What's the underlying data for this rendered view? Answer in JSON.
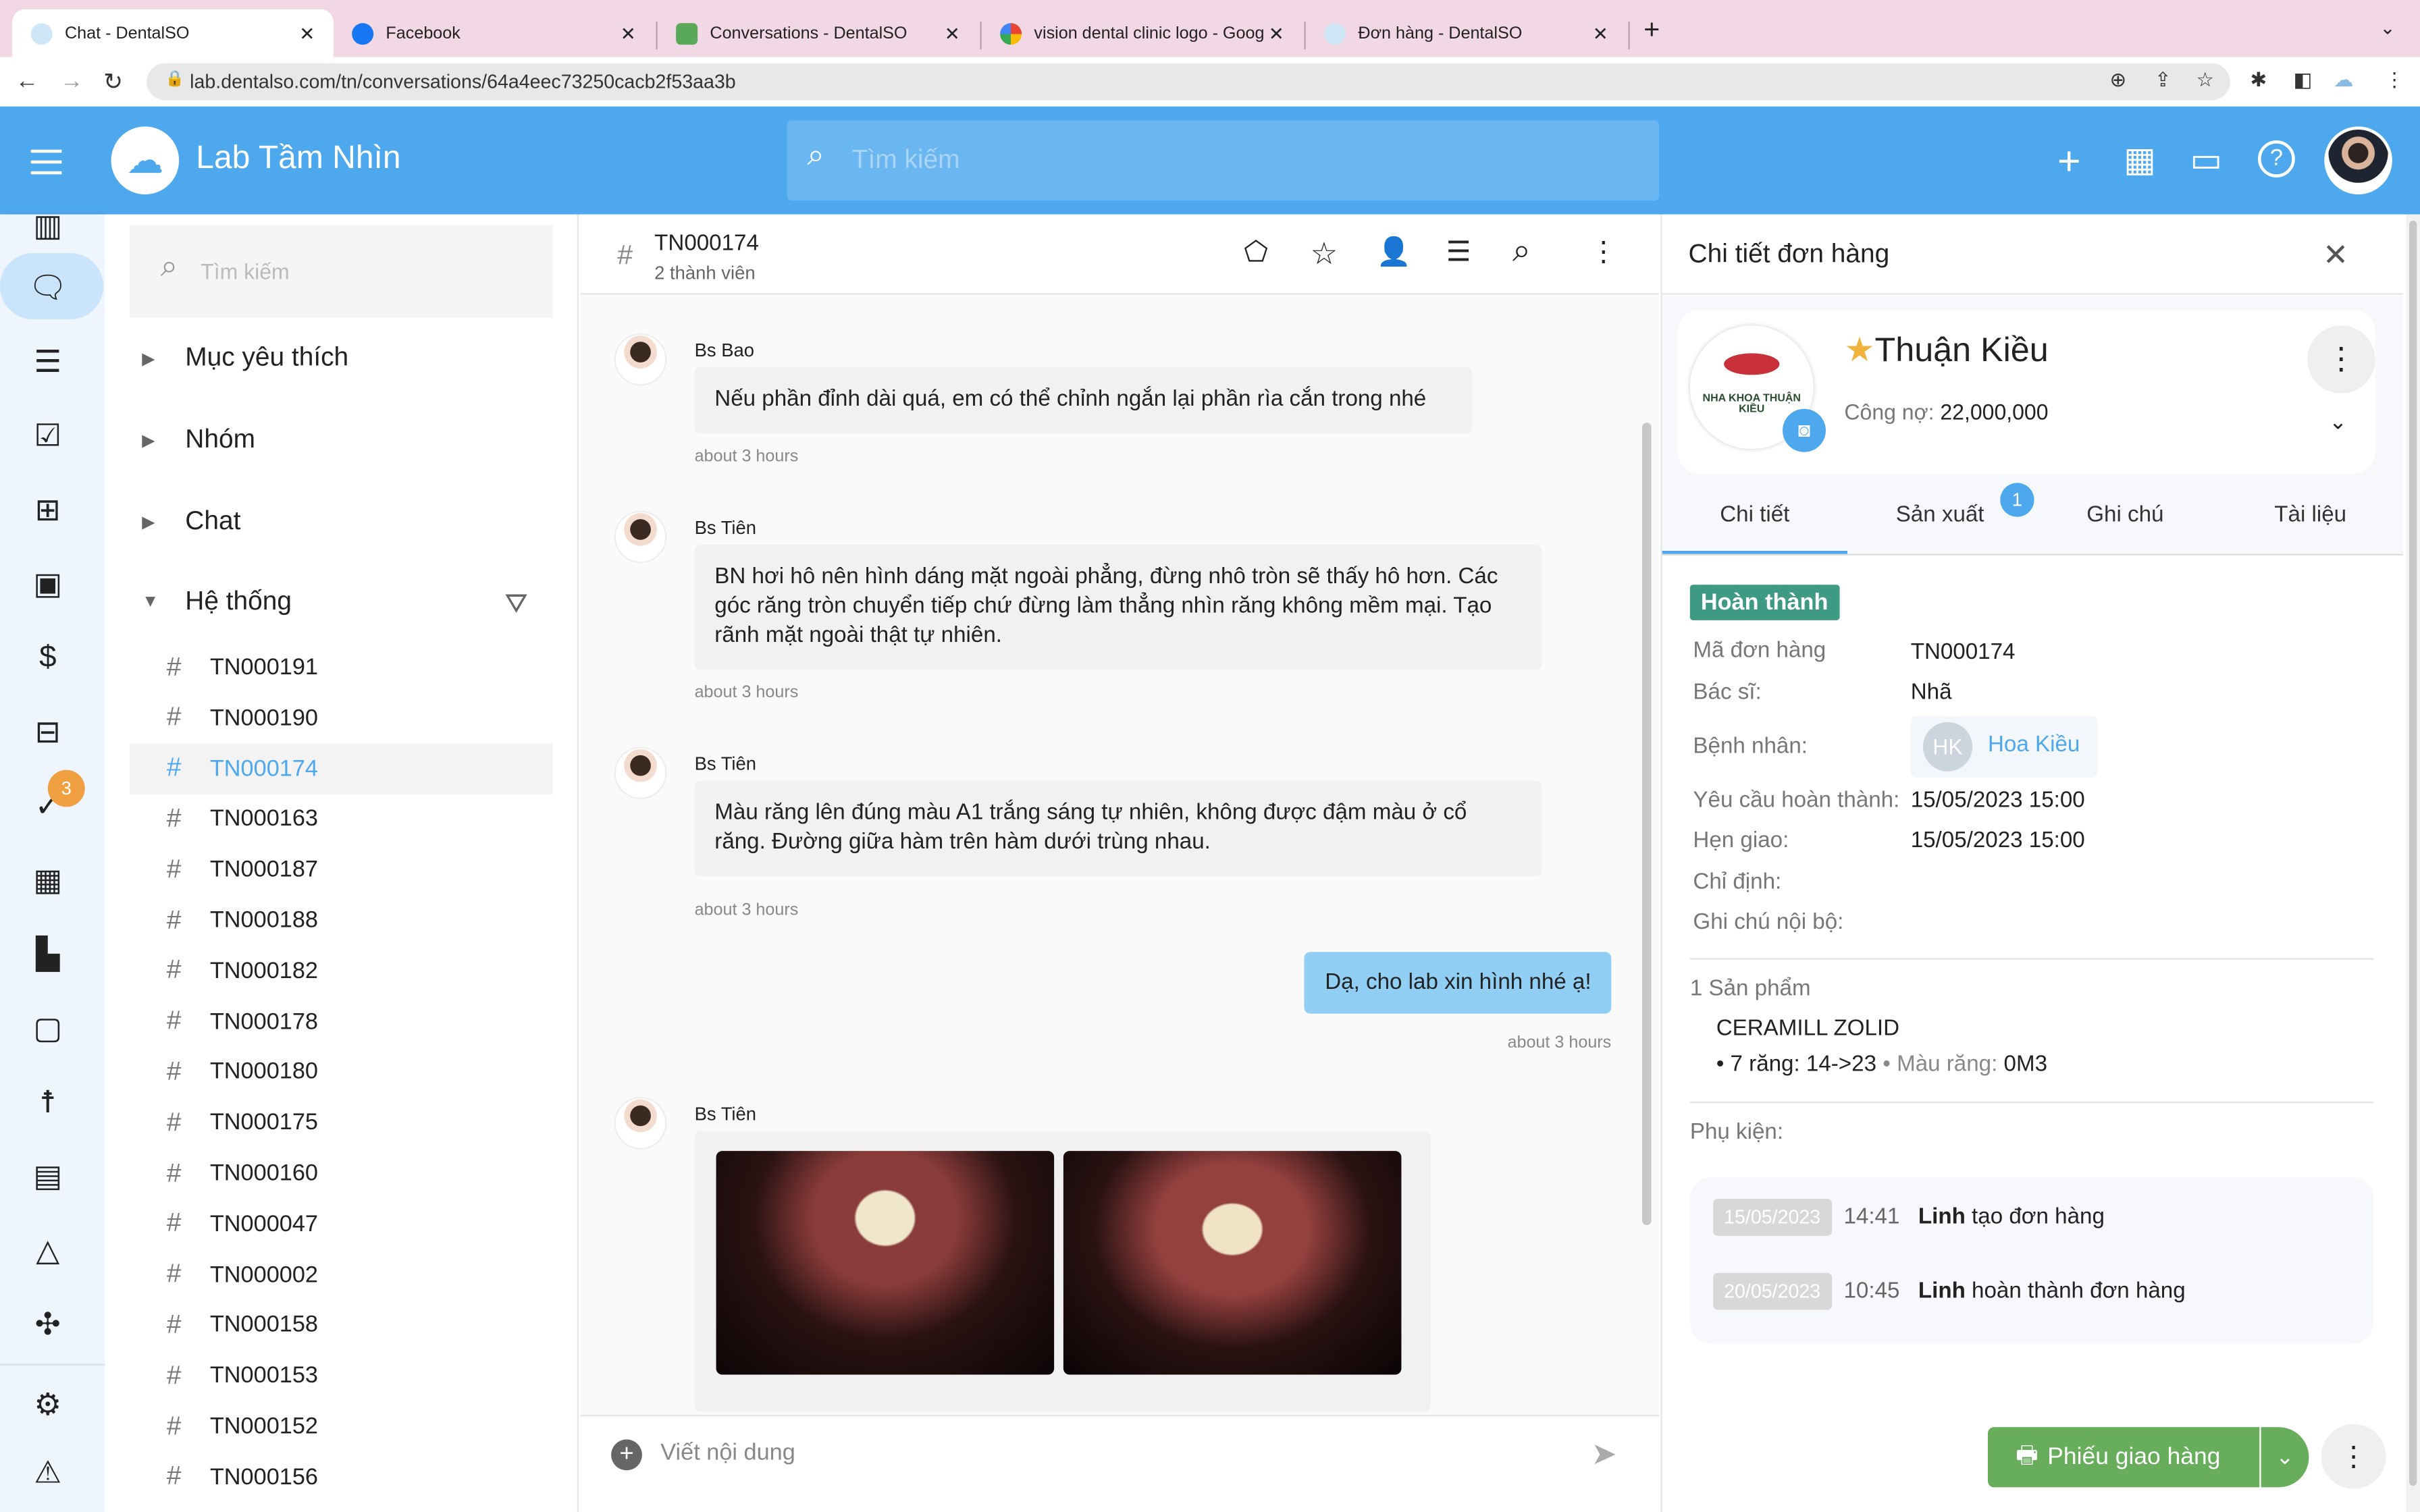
{
  "browser": {
    "tabs": [
      {
        "title": "Chat - DentalSO",
        "active": true
      },
      {
        "title": "Facebook"
      },
      {
        "title": "Conversations - DentalSO"
      },
      {
        "title": "vision dental clinic logo - Goog"
      },
      {
        "title": "Đơn hàng - DentalSO"
      }
    ],
    "url": "lab.dentalso.com/tn/conversations/64a4eec73250cacb2f53aa3b"
  },
  "header": {
    "brand": "Lab Tầm Nhìn",
    "search_placeholder": "Tìm kiếm",
    "accent": "#4ea8ed"
  },
  "rail": {
    "items": [
      "dashboard-icon",
      "chat-icon",
      "document-icon",
      "calendar-check-icon",
      "workflow-icon",
      "calendar-icon",
      "invoice-icon",
      "archive-icon",
      "tasks-icon",
      "qr-icon",
      "building-icon",
      "contacts-icon",
      "accessibility-icon",
      "report-icon",
      "shapes-icon",
      "network-icon",
      "settings-icon",
      "warning-icon"
    ],
    "tasks_badge": "3"
  },
  "list": {
    "search_placeholder": "Tìm kiếm",
    "groups": [
      "Mục yêu thích",
      "Nhóm",
      "Chat",
      "Hệ thống"
    ],
    "channels": [
      "TN000191",
      "TN000190",
      "TN000174",
      "TN000163",
      "TN000187",
      "TN000188",
      "TN000182",
      "TN000178",
      "TN000180",
      "TN000175",
      "TN000160",
      "TN000047",
      "TN000002",
      "TN000158",
      "TN000153",
      "TN000152",
      "TN000156"
    ],
    "selected": "TN000174"
  },
  "chat": {
    "title": "TN000174",
    "subtitle": "2 thành viên",
    "messages": [
      {
        "sender": "Bs Bao",
        "text": "Nếu phần đỉnh dài quá, em có thể chỉnh ngắn lại phần rìa cắn trong nhé",
        "time": "about 3 hours"
      },
      {
        "sender": "Bs Tiên",
        "text": "BN hơi hô nên hình dáng mặt ngoài phẳng, đừng nhô tròn sẽ thấy hô hơn. Các góc răng tròn chuyển tiếp chứ đừng làm thẳng nhìn răng không mềm mại. Tạo rãnh mặt ngoài thật tự nhiên.",
        "time": "about 3 hours"
      },
      {
        "sender": "Bs Tiên",
        "text": "Màu răng lên đúng màu A1 trắng sáng tự nhiên, không được đậm màu ở cổ răng. Đường giữa hàm trên hàm dưới trùng nhau.",
        "time": "about 3 hours"
      },
      {
        "sender": "me",
        "text": "Dạ, cho lab xin hình nhé ạ!",
        "time": "about 3 hours"
      },
      {
        "sender": "Bs Tiên",
        "images": 2
      }
    ],
    "composer_placeholder": "Viết nội dung"
  },
  "detail": {
    "title": "Chi tiết đơn hàng",
    "clinic_name": "Thuận Kiều",
    "logo_text": "NHA KHOA THUẬN KIỀU",
    "debt_label": "Công nợ:",
    "debt_value": "22,000,000",
    "tabs": [
      "Chi tiết",
      "Sản xuất",
      "Ghi chú",
      "Tài liệu"
    ],
    "production_badge": "1",
    "status": "Hoàn thành",
    "status_color": "#3f9a84",
    "fields": {
      "order_code_label": "Mã đơn hàng",
      "order_code": "TN000174",
      "doctor_label": "Bác sĩ:",
      "doctor": "Nhã",
      "patient_label": "Bệnh nhân:",
      "patient_initials": "HK",
      "patient": "Hoa Kiều",
      "due_label": "Yêu cầu hoàn thành:",
      "due": "15/05/2023 15:00",
      "delivery_label": "Hẹn giao:",
      "delivery": "15/05/2023 15:00",
      "indication_label": "Chỉ định:",
      "note_label": "Ghi chú nội bộ:"
    },
    "products_label": "1 Sản phẩm",
    "product_name": "CERAMILL ZOLID",
    "product_teeth": "7 răng: 14->23",
    "product_shade_label": "Màu răng:",
    "product_shade": "0M3",
    "accessories_label": "Phụ kiện:",
    "history": [
      {
        "date": "15/05/2023",
        "time": "14:41",
        "user": "Linh",
        "action": "tạo đơn hàng"
      },
      {
        "date": "20/05/2023",
        "time": "10:45",
        "user": "Linh",
        "action": "hoàn thành đơn hàng"
      }
    ],
    "print_button": "Phiếu giao hàng",
    "print_color": "#67ad5b"
  }
}
